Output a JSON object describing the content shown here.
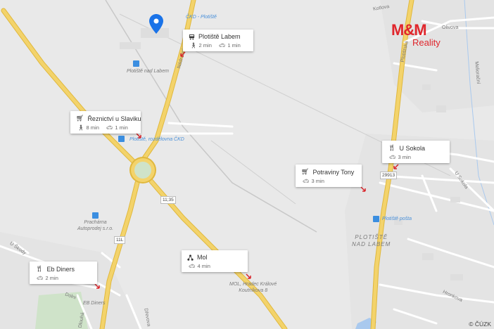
{
  "brand": {
    "logo_main": "M&M",
    "logo_sub": "Reality",
    "color": "#e0262c"
  },
  "attribution": "© ČÚZK",
  "map_labels": {
    "cd_plotiste": "ČKD - Plotiště",
    "plotiste_nad_labem_stop": "Plotiště nad Labem",
    "cd_bus_stop": "Plotiště, rozdělovna ČKD",
    "prachnik": "Prachárna\nAutoprodej s.r.o.",
    "mol_label": "MOL, Hradec Králové\nKoutníkova 8",
    "eb_diners_label": "EB Diners",
    "plotiste_posta": "Plotiště pošta",
    "town": "PLOTIŠTĚ\nNAD LABEM",
    "street_u_skody": "U Škody",
    "street_dolni": "Dolní",
    "street_nadrazni": "Nádražní",
    "street_kotlova": "Kotlova",
    "street_drevowa": "Dřevova",
    "street_hronkova": "Hronkova",
    "street_u_sokola": "U Sokola",
    "street_plotistska": "Plotišťská",
    "street_melioracka": "Meliorační",
    "street_olivova": "Olivova",
    "street_dlouha": "Dlouhá"
  },
  "road_numbers": {
    "r1": "11;35",
    "r2": "11L",
    "r3": "29913"
  },
  "pois": [
    {
      "id": "plotiste-labem",
      "title": "Plotiště Labem",
      "icon": "bus-icon",
      "walk": "2 min",
      "car": "1 min"
    },
    {
      "id": "reznictvi",
      "title": "Řeznictví u Slaviku",
      "icon": "shopping-cart-icon",
      "walk": "8 min",
      "car": "1 min"
    },
    {
      "id": "u-sokola",
      "title": "U Sokola",
      "icon": "restaurant-icon",
      "car": "3 min"
    },
    {
      "id": "potraviny-tony",
      "title": "Potraviny Tony",
      "icon": "shopping-cart-icon",
      "car": "3 min"
    },
    {
      "id": "mol",
      "title": "Mol",
      "icon": "fuel-network-icon",
      "car": "4 min"
    },
    {
      "id": "eb-diners",
      "title": "Eb Diners",
      "icon": "restaurant-icon",
      "car": "2 min"
    }
  ],
  "colors": {
    "road_main": "#f3d36b",
    "road_main_border": "#e0b83d",
    "road_minor": "#ffffff",
    "background": "#e9e9e9",
    "pin": "#1a73e8",
    "marker_red": "#d9262c"
  }
}
